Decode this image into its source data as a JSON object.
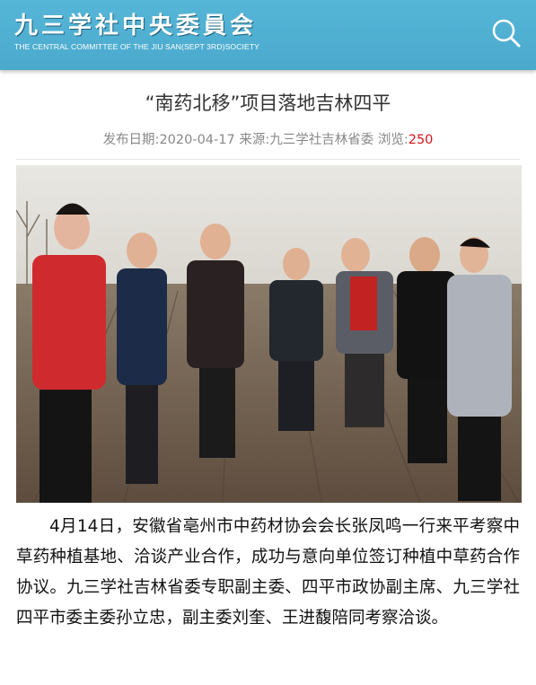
{
  "header": {
    "logo_main": "九三学社中央委員会",
    "logo_sub": "THE CENTRAL COMMITTEE OF THE JIU SAN(SEPT 3RD)SOCIETY",
    "search_icon": "search-icon"
  },
  "article": {
    "title": "“南药北移”项目落地吉林四平",
    "publish_label": "发布日期:",
    "publish_date": "2020-04-17",
    "source_label": "来源:",
    "source": "九三学社吉林省委",
    "views_label": "浏览:",
    "views": "250",
    "photo_alt": "考察人员在农田中交谈",
    "body": "4月14日，安徽省亳州市中药材协会会长张凤鸣一行来平考察中草药种植基地、洽谈产业合作，成功与意向单位签订种植中草药合作协议。九三学社吉林省委专职副主委、四平市政协副主席、九三学社四平市委主委孙立忠，副主委刘奎、王进馥陪同考察洽谈。"
  },
  "colors": {
    "header_bg": "#4aa9cc",
    "views_count": "#d9151b",
    "meta_text": "#888888"
  }
}
